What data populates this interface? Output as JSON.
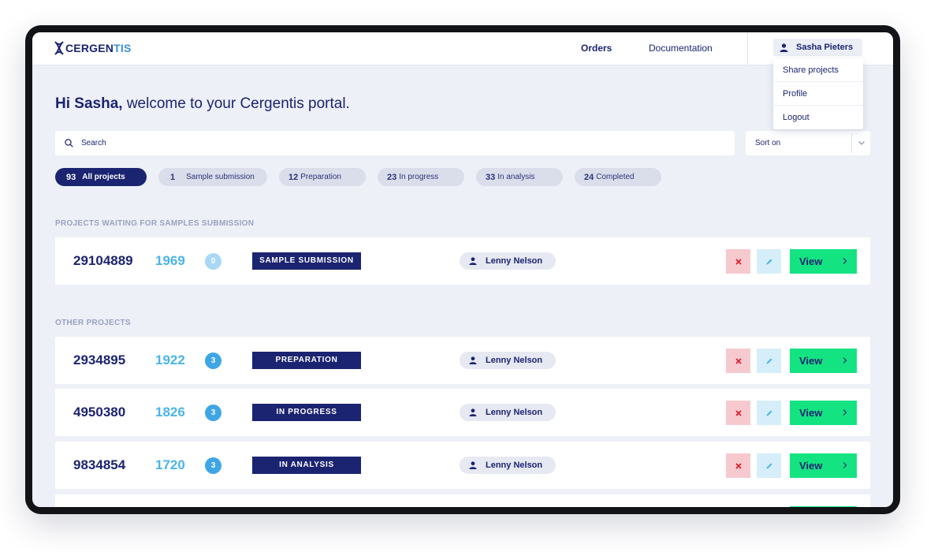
{
  "brand": {
    "logo_dark": "CERGEN",
    "logo_light": "TIS",
    "accent": "#1b2470",
    "highlight": "#4ab4ea",
    "success": "#14e382"
  },
  "nav": {
    "orders": "Orders",
    "documentation": "Documentation"
  },
  "user": {
    "name": "Sasha Pieters",
    "icon": "user-icon",
    "menu": [
      "Share projects",
      "Profile",
      "Logout"
    ]
  },
  "greeting": {
    "bold": "Hi Sasha,",
    "rest": " welcome to your Cergentis portal."
  },
  "search": {
    "placeholder": "Search",
    "icon": "search-icon"
  },
  "sort": {
    "label": "Sort on",
    "icon": "chevron-down-icon"
  },
  "filters": [
    {
      "count": "93",
      "label": "All projects",
      "active": true
    },
    {
      "count": "1",
      "label": "Sample submission"
    },
    {
      "count": "12",
      "label": "Preparation"
    },
    {
      "count": "23",
      "label": "In progress"
    },
    {
      "count": "33",
      "label": "In analysis"
    },
    {
      "count": "24",
      "label": "Completed"
    }
  ],
  "sections": {
    "waiting": "PROJECTS WAITING FOR SAMPLES SUBMISSION",
    "other": "OTHER PROJECTS"
  },
  "waiting_projects": [
    {
      "id": "29104889",
      "number": "1969",
      "samples": "0",
      "status": "SAMPLE SUBMISSION",
      "assignee": "Lenny Nelson"
    }
  ],
  "other_projects": [
    {
      "id": "2934895",
      "number": "1922",
      "samples": "3",
      "status": "PREPARATION",
      "assignee": "Lenny Nelson"
    },
    {
      "id": "4950380",
      "number": "1826",
      "samples": "3",
      "status": "IN PROGRESS",
      "assignee": "Lenny Nelson"
    },
    {
      "id": "9834854",
      "number": "1720",
      "samples": "3",
      "status": "IN ANALYSIS",
      "assignee": "Lenny Nelson"
    }
  ],
  "actions": {
    "view": "View",
    "delete_icon": "close-icon",
    "edit_icon": "pencil-icon",
    "view_icon": "chevron-right-icon"
  }
}
